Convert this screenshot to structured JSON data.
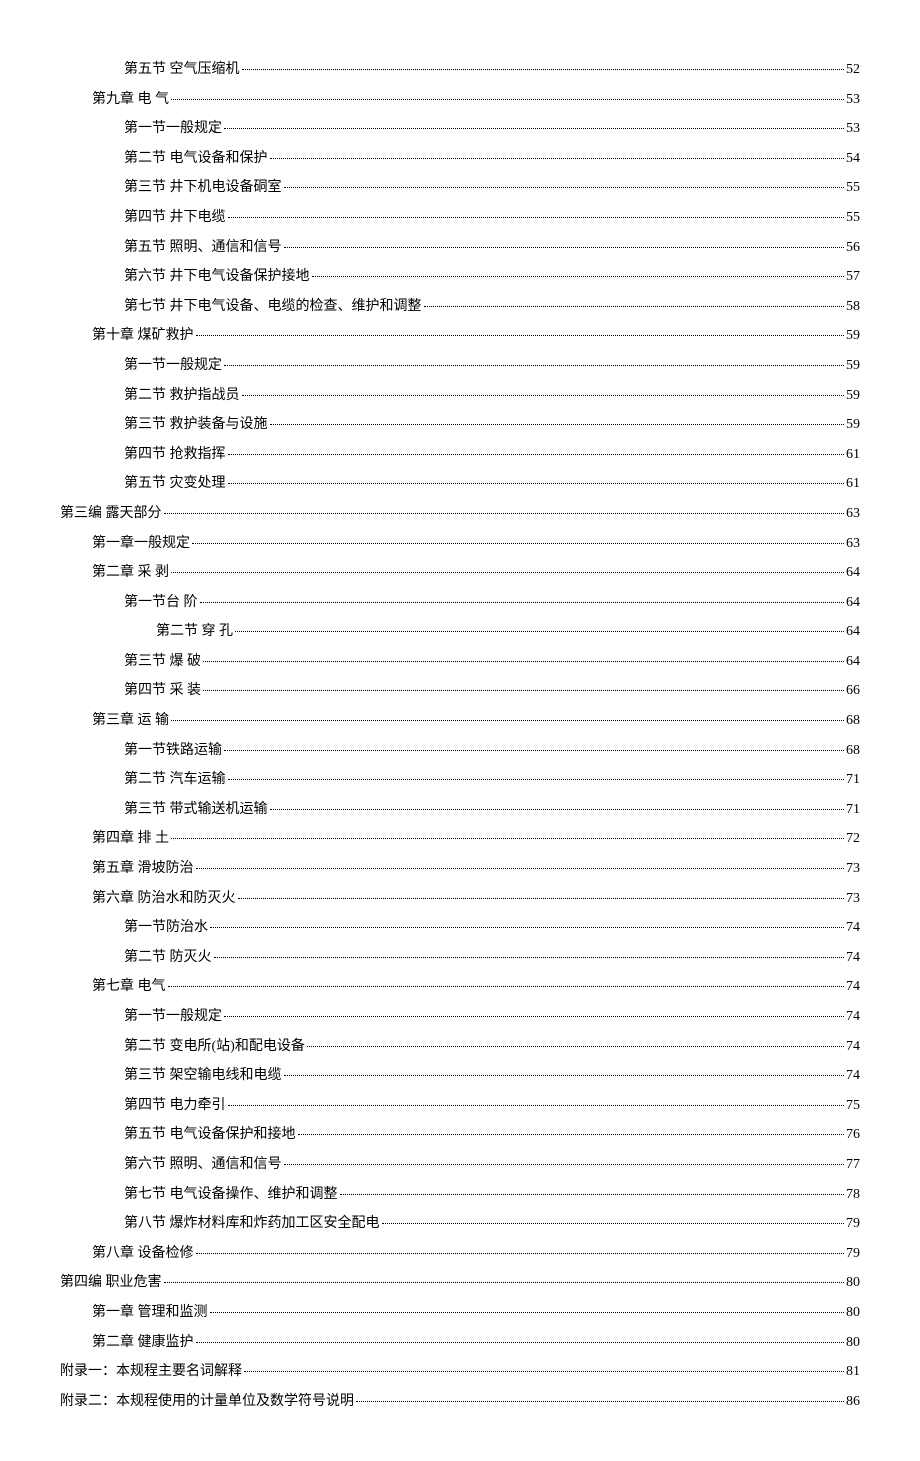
{
  "toc": [
    {
      "level": 2,
      "title": "第五节  空气压缩机",
      "page": "52"
    },
    {
      "level": 1,
      "title": "第九章  电  气",
      "page": "53"
    },
    {
      "level": 2,
      "title": "第一节一般规定",
      "page": "53"
    },
    {
      "level": 2,
      "title": "第二节  电气设备和保护",
      "page": "54"
    },
    {
      "level": 2,
      "title": "第三节  井下机电设备硐室",
      "page": "55"
    },
    {
      "level": 2,
      "title": "第四节  井下电缆",
      "page": "55"
    },
    {
      "level": 2,
      "title": "第五节  照明、通信和信号",
      "page": "56"
    },
    {
      "level": 2,
      "title": "第六节  井下电气设备保护接地",
      "page": "57"
    },
    {
      "level": 2,
      "title": "第七节  井下电气设备、电缆的检查、维护和调整",
      "page": "58"
    },
    {
      "level": 1,
      "title": "第十章  煤矿救护",
      "page": "59"
    },
    {
      "level": 2,
      "title": "第一节一般规定",
      "page": "59"
    },
    {
      "level": 2,
      "title": "第二节  救护指战员",
      "page": "59"
    },
    {
      "level": 2,
      "title": "第三节  救护装备与设施",
      "page": "59"
    },
    {
      "level": 2,
      "title": "第四节  抢救指挥",
      "page": "61"
    },
    {
      "level": 2,
      "title": "第五节  灾变处理",
      "page": "61"
    },
    {
      "level": 0,
      "title": "第三编  露天部分",
      "page": "63"
    },
    {
      "level": 1,
      "title": "第一章一般规定",
      "page": "63"
    },
    {
      "level": 1,
      "title": "第二章 采  剥",
      "page": "64"
    },
    {
      "level": 2,
      "title": "第一节台  阶",
      "page": "64"
    },
    {
      "level": 3,
      "title": "第二节  穿  孔",
      "page": "64"
    },
    {
      "level": 2,
      "title": "第三节  爆  破",
      "page": "64"
    },
    {
      "level": 2,
      "title": "第四节  采  装",
      "page": "66"
    },
    {
      "level": 1,
      "title": "第三章 运  输",
      "page": "68"
    },
    {
      "level": 2,
      "title": "第一节铁路运输",
      "page": "68"
    },
    {
      "level": 2,
      "title": "第二节  汽车运输",
      "page": "71"
    },
    {
      "level": 2,
      "title": "第三节  带式输送机运输",
      "page": "71"
    },
    {
      "level": 1,
      "title": "第四章  排  土",
      "page": "72"
    },
    {
      "level": 1,
      "title": "第五章  滑坡防治",
      "page": "73"
    },
    {
      "level": 1,
      "title": "第六章    防治水和防灭火",
      "page": "73"
    },
    {
      "level": 2,
      "title": "第一节防治水",
      "page": "74"
    },
    {
      "level": 2,
      "title": "第二节  防灭火",
      "page": "74"
    },
    {
      "level": 1,
      "title": "第七章    电气",
      "page": "74"
    },
    {
      "level": 2,
      "title": "第一节一般规定",
      "page": "74"
    },
    {
      "level": 2,
      "title": "第二节  变电所(站)和配电设备",
      "page": "74"
    },
    {
      "level": 2,
      "title": "第三节  架空输电线和电缆",
      "page": "74"
    },
    {
      "level": 2,
      "title": "第四节  电力牵引",
      "page": "75"
    },
    {
      "level": 2,
      "title": "第五节  电气设备保护和接地",
      "page": "76"
    },
    {
      "level": 2,
      "title": "第六节  照明、通信和信号",
      "page": "77"
    },
    {
      "level": 2,
      "title": "第七节  电气设备操作、维护和调整",
      "page": "78"
    },
    {
      "level": 2,
      "title": "第八节  爆炸材料库和炸药加工区安全配电",
      "page": "79"
    },
    {
      "level": 1,
      "title": "第八章  设备检修",
      "page": "79"
    },
    {
      "level": 0,
      "title": "第四编    职业危害",
      "page": "80"
    },
    {
      "level": 1,
      "title": "第一章    管理和监测",
      "page": "80"
    },
    {
      "level": 1,
      "title": "第二章    健康监护",
      "page": "80"
    },
    {
      "level": 0,
      "title": "附录一：本规程主要名词解释",
      "page": "81"
    },
    {
      "level": 0,
      "title": "附录二：本规程使用的计量单位及数学符号说明",
      "page": "86"
    }
  ]
}
